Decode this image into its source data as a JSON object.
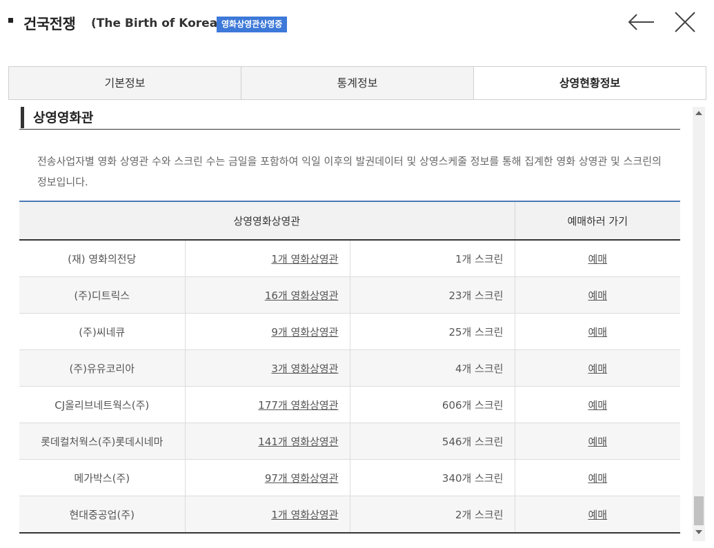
{
  "header": {
    "title": "건국전쟁",
    "subtitle": "(The Birth of Korea)",
    "badge": "영화상영관상영중",
    "back_icon": "arrow-left-icon",
    "close_icon": "close-icon"
  },
  "tabs": [
    {
      "label": "기본정보",
      "active": false
    },
    {
      "label": "통계정보",
      "active": false
    },
    {
      "label": "상영현황정보",
      "active": true
    }
  ],
  "section": {
    "title": "상영영화관",
    "description": "전송사업자별 영화 상영관 수와 스크린 수는 금일을 포함하여 익일 이후의 발권데이터 및 상영스케줄 정보를 통해 집계한 영화 상영관 및 스크린의 정보입니다."
  },
  "table": {
    "headers": [
      "상영영화상영관",
      "예매하러 가기"
    ],
    "rows": [
      {
        "name": "(재) 영화의전당",
        "theaters": "1개 영화상영관",
        "screens": "1개 스크린",
        "book": "예매"
      },
      {
        "name": "(주)디트릭스",
        "theaters": "16개 영화상영관",
        "screens": "23개 스크린",
        "book": "예매"
      },
      {
        "name": "(주)씨네큐",
        "theaters": "9개 영화상영관",
        "screens": "25개 스크린",
        "book": "예매"
      },
      {
        "name": "(주)유유코리아",
        "theaters": "3개 영화상영관",
        "screens": "4개 스크린",
        "book": "예매"
      },
      {
        "name": "CJ올리브네트웍스(주)",
        "theaters": "177개 영화상영관",
        "screens": "606개 스크린",
        "book": "예매"
      },
      {
        "name": "롯데컬처웍스(주)롯데시네마",
        "theaters": "141개 영화상영관",
        "screens": "546개 스크린",
        "book": "예매"
      },
      {
        "name": "메가박스(주)",
        "theaters": "97개 영화상영관",
        "screens": "340개 스크린",
        "book": "예매"
      },
      {
        "name": "현대중공업(주)",
        "theaters": "1개 영화상영관",
        "screens": "2개 스크린",
        "book": "예매"
      }
    ]
  },
  "colors": {
    "accent": "#3d79d8",
    "table_top_border": "#4c78b5",
    "header_bg": "#f2f2f2"
  }
}
